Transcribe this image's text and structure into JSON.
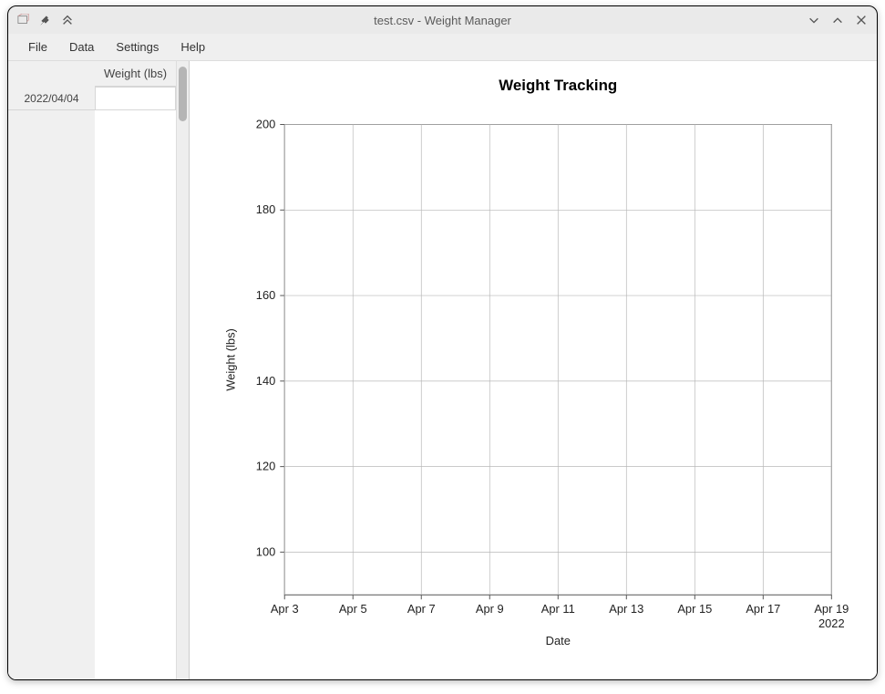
{
  "window": {
    "title": "test.csv - Weight Manager"
  },
  "menubar": {
    "items": [
      "File",
      "Data",
      "Settings",
      "Help"
    ]
  },
  "table": {
    "column_header": "Weight (lbs)",
    "rows": [
      {
        "date": "2022/04/04",
        "value": ""
      }
    ]
  },
  "chart_data": {
    "type": "line",
    "title": "Weight Tracking",
    "xlabel": "Date",
    "ylabel": "Weight (lbs)",
    "x_ticks": [
      "Apr 3",
      "Apr 5",
      "Apr 7",
      "Apr 9",
      "Apr 11",
      "Apr 13",
      "Apr 15",
      "Apr 17",
      "Apr 19"
    ],
    "x_year_label": "2022",
    "y_ticks": [
      100,
      120,
      140,
      160,
      180,
      200
    ],
    "ylim": [
      90,
      200
    ],
    "series": []
  }
}
